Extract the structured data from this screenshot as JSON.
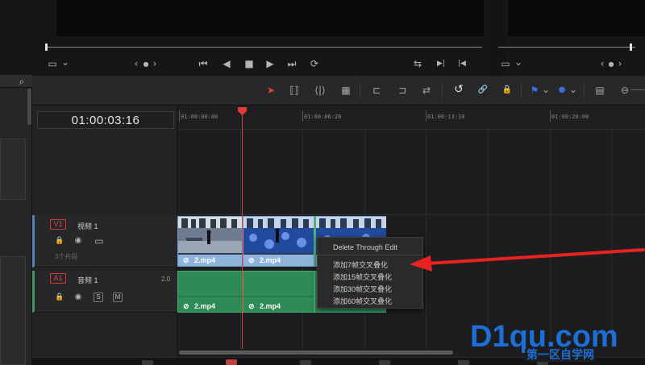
{
  "viewer": {
    "left_controls": {
      "view_icon": "▭",
      "dropdown_icon": "⌄",
      "prev_icon": "‹",
      "dot_icon": "●",
      "next_icon": "›",
      "skip_start": "⏮",
      "play_reverse": "◀",
      "stop": "■",
      "play": "▶",
      "skip_end": "⏭",
      "loop": "⟳"
    },
    "right_controls": {
      "match_icon": "⇆",
      "next_edit": "▶|",
      "prev_edit": "|◀",
      "view_icon": "▭",
      "dropdown_icon": "⌄",
      "prev_icon": "‹",
      "dot_icon": "●",
      "next_icon": "›"
    }
  },
  "toolbar": {
    "search_icon": "⌕",
    "select_icon": "➤",
    "trim_icon": "⟦⟧",
    "dynamic_trim_icon": "⟨|⟩",
    "blade_icon": "▦",
    "insert_icon": "⊏",
    "overwrite_icon": "⊐",
    "replace_icon": "⇄",
    "snapping_icon": "↺",
    "link_icon": "🔗",
    "lock_icon": "🔒",
    "flag_icon": "⚑",
    "marker_icon": "●",
    "zoom_icon": "▤",
    "zoom_out_icon": "⊖",
    "dropdown": "⌄"
  },
  "timecode": "01:00:03:16",
  "ruler": {
    "labels": [
      "01:00:00:00",
      "01:00:06:20",
      "01:00:13:10",
      "01:00:20:00"
    ]
  },
  "tracks": {
    "video": {
      "badge": "V1",
      "name": "视频 1",
      "sub": "3个片段",
      "lock_icon": "🔒",
      "eye_icon": "◉",
      "screen_icon": "▭"
    },
    "audio": {
      "badge": "A1",
      "name": "音频 1",
      "level": "2.0",
      "lock_icon": "🔒",
      "eye_icon": "◉",
      "solo": "S",
      "mute": "M"
    }
  },
  "clips": {
    "video": [
      {
        "label": "2.mp4"
      },
      {
        "label": "2.mp4"
      },
      {
        "label": "2.mp4"
      }
    ],
    "audio": [
      {
        "label": "2.mp4"
      },
      {
        "label": "2.mp4"
      }
    ],
    "link_icon": "⊘"
  },
  "context_menu": {
    "items": [
      "Delete Through Edit",
      "添加7帧交叉叠化",
      "添加15帧交叉叠化",
      "添加30帧交叉叠化",
      "添加60帧交叉叠化"
    ]
  },
  "watermark": {
    "brand": "D1qu.com",
    "tagline": "第一区自学网"
  },
  "colors": {
    "playhead": "#e53935",
    "arrow": "#e8231f",
    "video_clip": "#8fb4dc",
    "audio_clip": "#2e8a56",
    "watermark": "#1b6fd6"
  }
}
